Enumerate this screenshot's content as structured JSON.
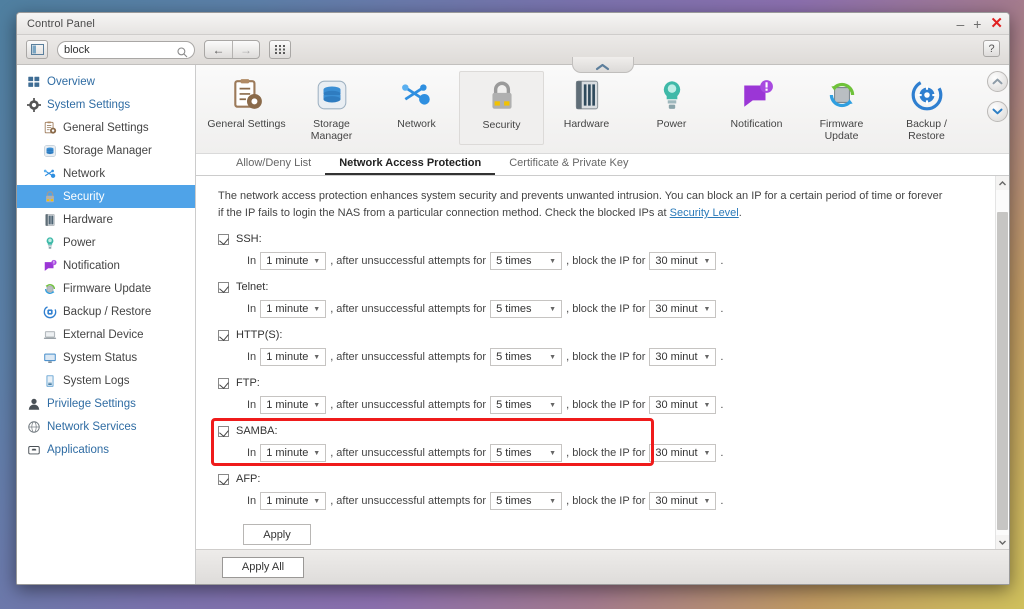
{
  "window": {
    "title": "Control Panel",
    "minimize": "–",
    "maximize": "+",
    "close": "✕",
    "help": "?"
  },
  "toolbar": {
    "panel_toggle_icon": "sidebar-toggle-icon",
    "search_value": "block",
    "search_placeholder": "",
    "back_label": "←",
    "forward_label": "→",
    "grid_icon": "app-grid-icon"
  },
  "sidebar": {
    "items": [
      {
        "label": "Overview",
        "icon": "overview-icon",
        "level": 0,
        "selected": false
      },
      {
        "label": "System Settings",
        "icon": "gear-icon",
        "level": 0,
        "selected": false
      },
      {
        "label": "General Settings",
        "icon": "clipboard-gear-icon",
        "level": 1,
        "selected": false
      },
      {
        "label": "Storage Manager",
        "icon": "storage-icon",
        "level": 1,
        "selected": false
      },
      {
        "label": "Network",
        "icon": "network-icon",
        "level": 1,
        "selected": false
      },
      {
        "label": "Security",
        "icon": "lock-icon",
        "level": 1,
        "selected": true
      },
      {
        "label": "Hardware",
        "icon": "hardware-icon",
        "level": 1,
        "selected": false
      },
      {
        "label": "Power",
        "icon": "power-bulb-icon",
        "level": 1,
        "selected": false
      },
      {
        "label": "Notification",
        "icon": "notification-icon",
        "level": 1,
        "selected": false
      },
      {
        "label": "Firmware Update",
        "icon": "firmware-update-icon",
        "level": 1,
        "selected": false
      },
      {
        "label": "Backup / Restore",
        "icon": "backup-restore-icon",
        "level": 1,
        "selected": false
      },
      {
        "label": "External Device",
        "icon": "external-device-icon",
        "level": 1,
        "selected": false
      },
      {
        "label": "System Status",
        "icon": "system-status-icon",
        "level": 1,
        "selected": false
      },
      {
        "label": "System Logs",
        "icon": "system-logs-icon",
        "level": 1,
        "selected": false
      },
      {
        "label": "Privilege Settings",
        "icon": "user-icon",
        "level": 0,
        "selected": false
      },
      {
        "label": "Network Services",
        "icon": "globe-icon",
        "level": 0,
        "selected": false
      },
      {
        "label": "Applications",
        "icon": "applications-icon",
        "level": 0,
        "selected": false
      }
    ]
  },
  "app_icons": {
    "collapse_icon": "chevron-up-icon",
    "scroll_up_icon": "chevron-up-icon",
    "scroll_down_icon": "chevron-down-icon",
    "items": [
      {
        "label": "General Settings",
        "icon": "clipboard-gear-icon",
        "active": false
      },
      {
        "label": "Storage\nManager",
        "icon": "storage-icon",
        "active": false
      },
      {
        "label": "Network",
        "icon": "network-icon",
        "active": false
      },
      {
        "label": "Security",
        "icon": "lock-icon",
        "active": true
      },
      {
        "label": "Hardware",
        "icon": "hardware-icon",
        "active": false
      },
      {
        "label": "Power",
        "icon": "power-bulb-icon",
        "active": false
      },
      {
        "label": "Notification",
        "icon": "notification-icon",
        "active": false
      },
      {
        "label": "Firmware\nUpdate",
        "icon": "firmware-update-icon",
        "active": false
      },
      {
        "label": "Backup /\nRestore",
        "icon": "backup-restore-icon",
        "active": false
      }
    ]
  },
  "tabs": [
    {
      "label": "Allow/Deny List",
      "active": false
    },
    {
      "label": "Network Access Protection",
      "active": true
    },
    {
      "label": "Certificate & Private Key",
      "active": false
    }
  ],
  "main": {
    "description_part1": "The network access protection enhances system security and prevents unwanted intrusion. You can block an IP for a certain period of time or forever if the IP fails to login the NAS from a particular connection method. Check the blocked IPs at ",
    "description_link": "Security Level",
    "description_part3": ".",
    "row_text": {
      "in": "In",
      "after_attempts": ", after unsuccessful attempts for",
      "block_ip": ", block the IP for",
      "period": "."
    },
    "services": [
      {
        "name": "SSH:",
        "checked": true,
        "interval": "1 minute",
        "attempts": "5 times",
        "block": "30 minut",
        "highlighted": false
      },
      {
        "name": "Telnet:",
        "checked": true,
        "interval": "1 minute",
        "attempts": "5 times",
        "block": "30 minut",
        "highlighted": false
      },
      {
        "name": "HTTP(S):",
        "checked": true,
        "interval": "1 minute",
        "attempts": "5 times",
        "block": "30 minut",
        "highlighted": false
      },
      {
        "name": "FTP:",
        "checked": true,
        "interval": "1 minute",
        "attempts": "5 times",
        "block": "30 minut",
        "highlighted": false
      },
      {
        "name": "SAMBA:",
        "checked": true,
        "interval": "1 minute",
        "attempts": "5 times",
        "block": "30 minut",
        "highlighted": true
      },
      {
        "name": "AFP:",
        "checked": true,
        "interval": "1 minute",
        "attempts": "5 times",
        "block": "30 minut",
        "highlighted": false
      }
    ],
    "apply_label": "Apply",
    "apply_all_label": "Apply All"
  },
  "colors": {
    "accent": "#4fa3e8",
    "link": "#2a7ab9",
    "highlight": "#ef1b1b",
    "sidebar_link": "#2f6ca3"
  }
}
